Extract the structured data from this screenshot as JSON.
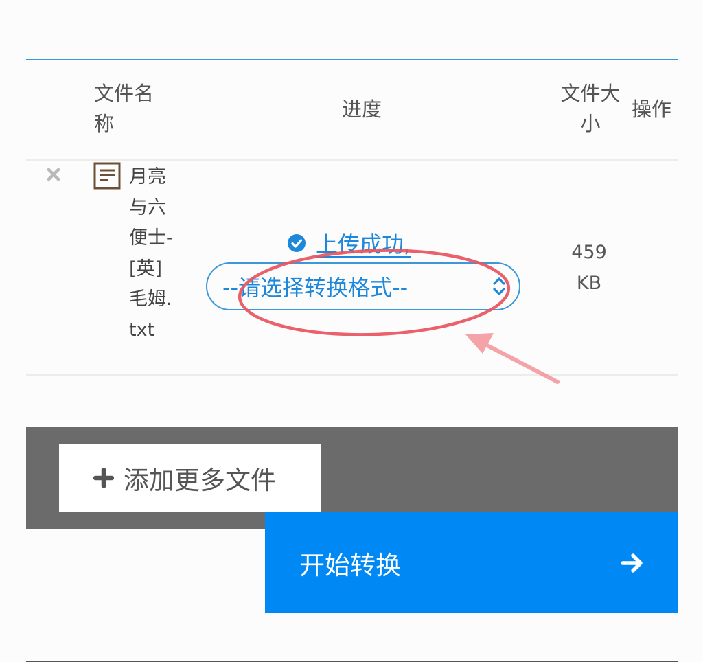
{
  "table": {
    "headers": {
      "name": "文件名称",
      "progress": "进度",
      "size": "文件大小",
      "action": "操作"
    },
    "rows": [
      {
        "file_name": "月亮与六便士-[英]毛姆.txt",
        "status": "上传成功,",
        "format_placeholder": "--请选择转换格式--",
        "size": "459 KB"
      }
    ]
  },
  "buttons": {
    "add_files": "添加更多文件",
    "start_conversion": "开始转换"
  },
  "icons": {
    "remove": "close-icon",
    "file": "text-file-icon",
    "status": "check-circle-icon",
    "select": "chevron-up-down-icon",
    "add": "plus-icon",
    "start": "arrow-right-icon"
  },
  "colors": {
    "accent": "#0088f4",
    "link": "#1d87da",
    "annotation": "#e8545e"
  }
}
